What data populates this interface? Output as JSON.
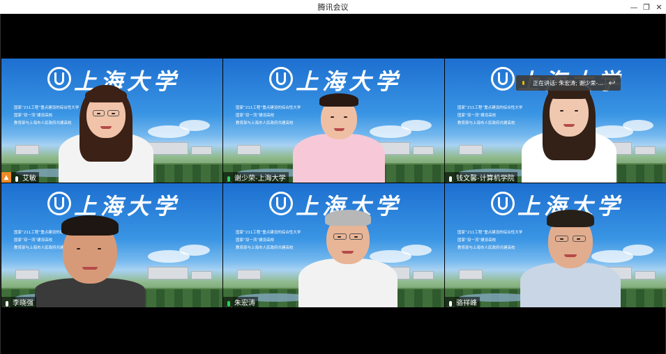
{
  "window": {
    "title": "腾讯会议",
    "minimize_glyph": "—",
    "maximize_glyph": "❐",
    "close_glyph": "✕"
  },
  "background": {
    "university_name": "上海大学",
    "slogans": [
      "国家“211工程”重点建设的综合性大学",
      "国家“双一流”建设高校",
      "教育部与上海市人民政府共建高校"
    ]
  },
  "participants": [
    {
      "name": "艾敏",
      "host": true,
      "mic_active": false
    },
    {
      "name": "谢少荣-上海大学",
      "host": false,
      "mic_active": true
    },
    {
      "name": "钱文馨-计算机学院",
      "host": false,
      "mic_active": false
    },
    {
      "name": "李晓强",
      "host": false,
      "mic_active": false
    },
    {
      "name": "朱宏涛",
      "host": false,
      "mic_active": true
    },
    {
      "name": "骆祥峰",
      "host": false,
      "mic_active": false
    }
  ],
  "speaking_banner": {
    "text": "正在讲话: 朱宏涛; 谢少荣-...",
    "reply_icon": "↩"
  },
  "colors": {
    "host_badge": "#f08a24",
    "mic_active": "#2ed15a"
  }
}
